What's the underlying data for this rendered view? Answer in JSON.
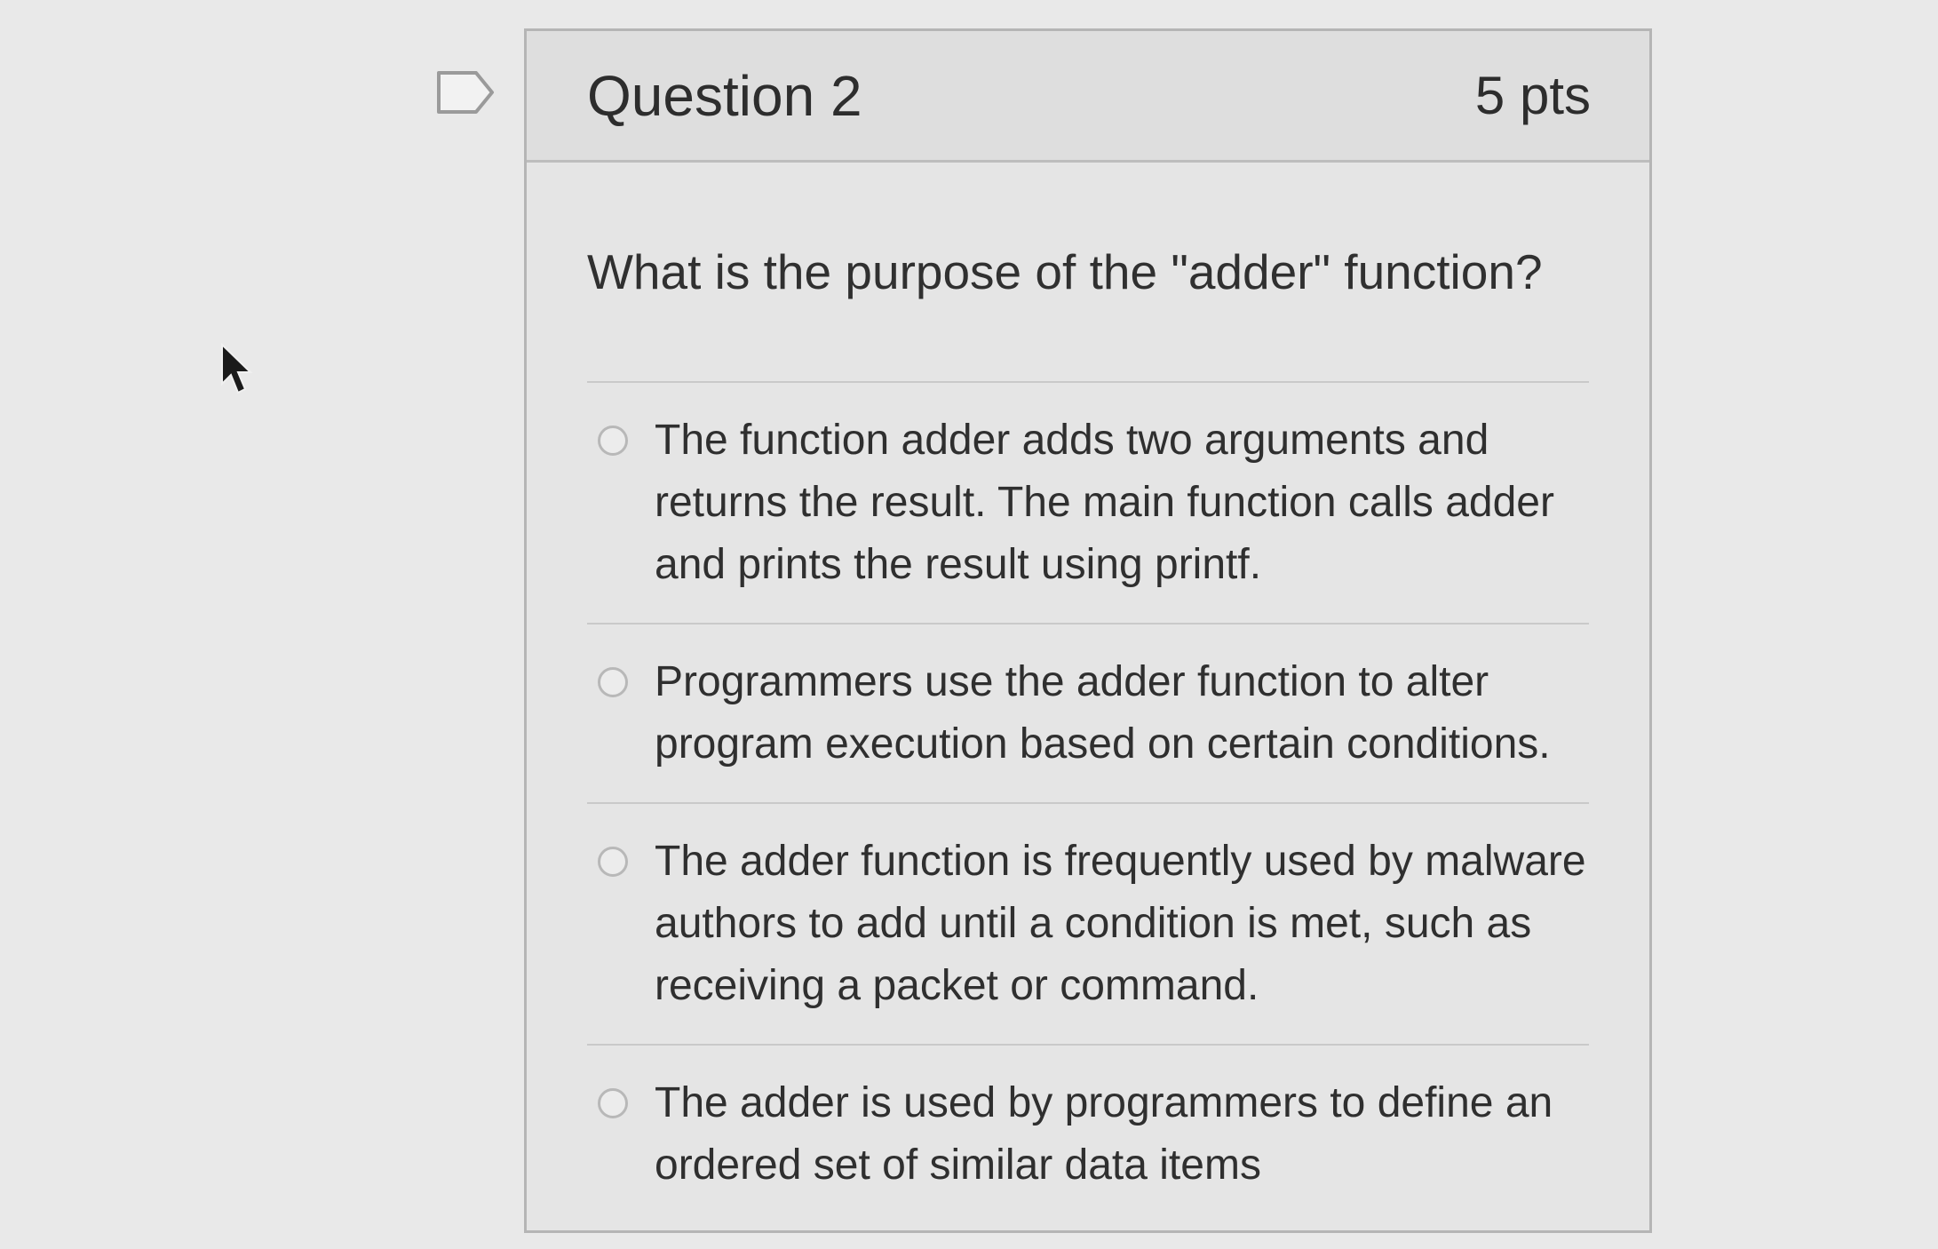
{
  "question": {
    "title": "Question 2",
    "points": "5 pts",
    "text": "What is the purpose of the \"adder\" function?",
    "answers": [
      {
        "label": "The function adder adds two arguments and returns the result. The main function calls adder and prints the result using printf."
      },
      {
        "label": "Programmers use the adder function to alter program execution based on certain conditions."
      },
      {
        "label": "The adder function is frequently used by malware authors to add until a condition is met, such as receiving a packet or command."
      },
      {
        "label": "The adder is used by programmers to define an ordered set of similar data items"
      }
    ]
  },
  "icons": {
    "flag": "flag-question-icon",
    "cursor": "mouse-pointer-icon"
  },
  "colors": {
    "background": "#e9e9e9",
    "card": "#e5e5e5",
    "header": "#dedede",
    "border": "#b5b5b5",
    "text": "#2d2d2d"
  }
}
